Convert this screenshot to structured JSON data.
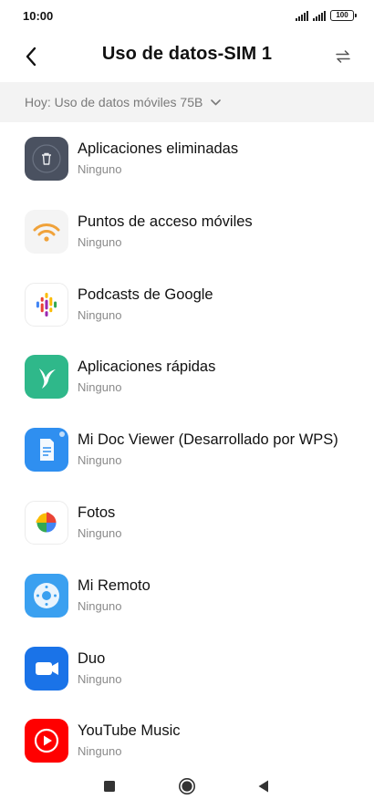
{
  "status_bar": {
    "time": "10:00",
    "battery": "100"
  },
  "header": {
    "title": "Uso de datos-SIM 1",
    "back_icon": "chevron-left-icon",
    "swap_icon": "swap-arrows-icon"
  },
  "filter": {
    "label": "Hoy: Uso de datos móviles 75B",
    "icon": "chevron-down-icon"
  },
  "apps": [
    {
      "name": "Aplicaciones eliminadas",
      "usage": "Ninguno",
      "icon": "trash-icon"
    },
    {
      "name": "Puntos de acceso móviles",
      "usage": "Ninguno",
      "icon": "wifi-hotspot-icon"
    },
    {
      "name": "Podcasts de Google",
      "usage": "Ninguno",
      "icon": "google-podcasts-icon"
    },
    {
      "name": "Aplicaciones rápidas",
      "usage": "Ninguno",
      "icon": "hummingbird-icon"
    },
    {
      "name": "Mi Doc Viewer (Desarrollado por WPS)",
      "usage": "Ninguno",
      "icon": "doc-viewer-icon"
    },
    {
      "name": "Fotos",
      "usage": "Ninguno",
      "icon": "google-photos-icon"
    },
    {
      "name": "Mi Remoto",
      "usage": "Ninguno",
      "icon": "remote-control-icon"
    },
    {
      "name": "Duo",
      "usage": "Ninguno",
      "icon": "video-camera-icon"
    },
    {
      "name": "YouTube Music",
      "usage": "Ninguno",
      "icon": "youtube-music-icon"
    }
  ],
  "nav": {
    "recents_icon": "square-icon",
    "home_icon": "circle-icon",
    "back_icon": "triangle-back-icon"
  },
  "colors": {
    "filter_bg": "#f3f3f3",
    "hotspot_orange": "#f0a23a",
    "quick_apps_green": "#2fb88a",
    "doc_viewer_blue": "#2f8ff0",
    "remote_blue": "#3aa0f0",
    "duo_blue": "#1a73e8",
    "youtube_red": "#ff0000"
  }
}
